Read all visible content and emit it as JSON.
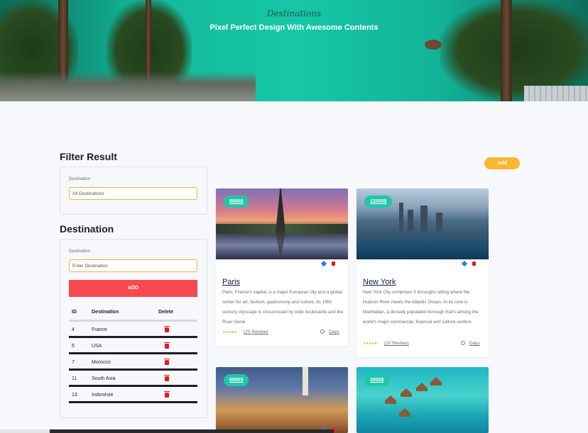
{
  "hero": {
    "subtitle": "Destinations",
    "title": "Pixel Perfect Design With Awesome Contents"
  },
  "filter": {
    "title": "Filter Result",
    "label": "Destination",
    "value": "All Destinations"
  },
  "destination_form": {
    "title": "Destination",
    "label": "Destination",
    "placeholder": "Enter Destination",
    "add_label": "ADD"
  },
  "table": {
    "headers": [
      "ID",
      "Destination",
      "Delete"
    ],
    "rows": [
      {
        "id": "4",
        "name": "France"
      },
      {
        "id": "5",
        "name": "USA"
      },
      {
        "id": "7",
        "name": "Morocco"
      },
      {
        "id": "11",
        "name": "South Asia"
      },
      {
        "id": "13",
        "name": "Indonésie"
      }
    ]
  },
  "add_button": "Add",
  "cards": [
    {
      "price": "8000$",
      "title": "Paris",
      "description": "Paris, France's capital, is a major European city and a global center for art, fashion, gastronomy and culture. Its 19th-century cityscape is crisscrossed by wide boulevards and the River Seine",
      "stars": "★★★★★",
      "reviews": "(20 Review)",
      "days": "Days"
    },
    {
      "price": "12000$",
      "title": "New York",
      "description": "New York City comprises 5 boroughs sitting where the Hudson River meets the Atlantic Ocean. At its core is Manhattan, a densely populated borough that's among the world's major commercial, financial and culture centers",
      "stars": "★★★★★",
      "reviews": "(20 Review)",
      "days": "Days"
    },
    {
      "price": "6500$"
    },
    {
      "price": "3000$"
    }
  ],
  "colors": {
    "accent_yellow": "#fbb730",
    "accent_red": "#f84a4e",
    "accent_teal": "#20c6aa",
    "title_navy": "#0e1c4a"
  }
}
